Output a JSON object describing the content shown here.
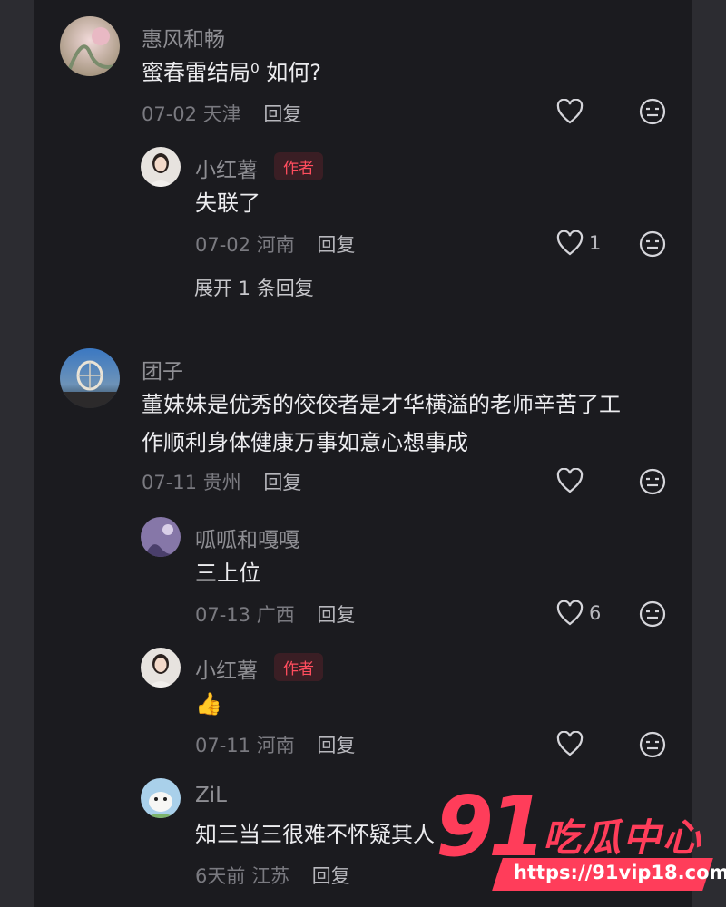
{
  "colors": {
    "background": "#1b1b1f",
    "author_tag": "#ff4d5e",
    "watermark": "#ff3d5a"
  },
  "comments": [
    {
      "name": "惠风和畅",
      "text": "蜜春雷结局⁰ 如何?",
      "date": "07-02",
      "location": "天津",
      "reply_label": "回复",
      "likes": "",
      "replies": [
        {
          "name": "小红薯",
          "tag": "作者",
          "text": "失联了",
          "date": "07-02",
          "location": "河南",
          "reply_label": "回复",
          "likes": "1"
        }
      ],
      "expand_label": "展开 1 条回复"
    },
    {
      "name": "团子",
      "text_line1": "董妹妹是优秀的佼佼者是才华横溢的老师辛苦了工",
      "text_line2": "作顺利身体健康万事如意心想事成",
      "date": "07-11",
      "location": "贵州",
      "reply_label": "回复",
      "likes": "",
      "replies": [
        {
          "name": "呱呱和嘎嘎",
          "text": "三上位",
          "date": "07-13",
          "location": "广西",
          "reply_label": "回复",
          "likes": "6"
        },
        {
          "name": "小红薯",
          "tag": "作者",
          "text": "👍",
          "date": "07-11",
          "location": "河南",
          "reply_label": "回复",
          "likes": ""
        },
        {
          "name": "ZiL",
          "text": "知三当三很难不怀疑其人",
          "date": "6天前",
          "location": "江苏",
          "reply_label": "回复",
          "likes": ""
        }
      ]
    }
  ],
  "watermark": {
    "number": "91",
    "text": "吃瓜中心",
    "url": "https://91vip18.com"
  },
  "icons": {
    "like": "heart-outline-icon",
    "emoji": "neutral-face-icon"
  }
}
